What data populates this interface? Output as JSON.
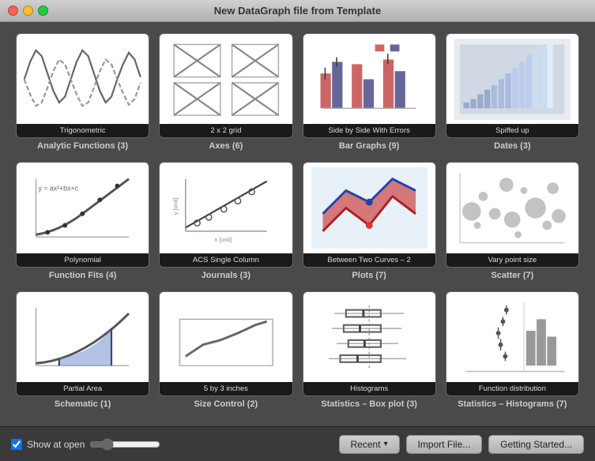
{
  "titleBar": {
    "title": "New DataGraph file from Template"
  },
  "templates": [
    {
      "id": "trigonometric",
      "label": "Trigonometric",
      "category": "Analytic Functions (3)",
      "preview": "trig"
    },
    {
      "id": "2x2grid",
      "label": "2 x 2 grid",
      "category": "Axes (6)",
      "preview": "grid2x2"
    },
    {
      "id": "side-by-side",
      "label": "Side by Side With Errors",
      "category": "Bar Graphs (9)",
      "preview": "bar"
    },
    {
      "id": "spiffed-up",
      "label": "Spiffed up",
      "category": "Dates (3)",
      "preview": "spiffed"
    },
    {
      "id": "polynomial",
      "label": "Polynomial",
      "category": "Function Fits (4)",
      "preview": "poly"
    },
    {
      "id": "acs-single",
      "label": "ACS Single Column",
      "category": "Journals (3)",
      "preview": "acs"
    },
    {
      "id": "between-curves",
      "label": "Between Two Curves – 2",
      "category": "Plots (7)",
      "preview": "curves"
    },
    {
      "id": "vary-point",
      "label": "Vary point size",
      "category": "Scatter (7)",
      "preview": "scatter"
    },
    {
      "id": "partial-area",
      "label": "Partial Area",
      "category": "Schematic (1)",
      "preview": "area"
    },
    {
      "id": "5by3",
      "label": "5 by 3 inches",
      "category": "Size Control (2)",
      "preview": "size"
    },
    {
      "id": "histograms",
      "label": "Histograms",
      "category": "Statistics – Box plot (3)",
      "preview": "hist"
    },
    {
      "id": "func-dist",
      "label": "Function distribution",
      "category": "Statistics – Histograms (7)",
      "preview": "funcdist"
    }
  ],
  "bottomBar": {
    "checkboxLabel": "Show at open",
    "checkboxChecked": true,
    "buttons": {
      "recent": "Recent",
      "importFile": "Import File...",
      "gettingStarted": "Getting Started..."
    }
  }
}
